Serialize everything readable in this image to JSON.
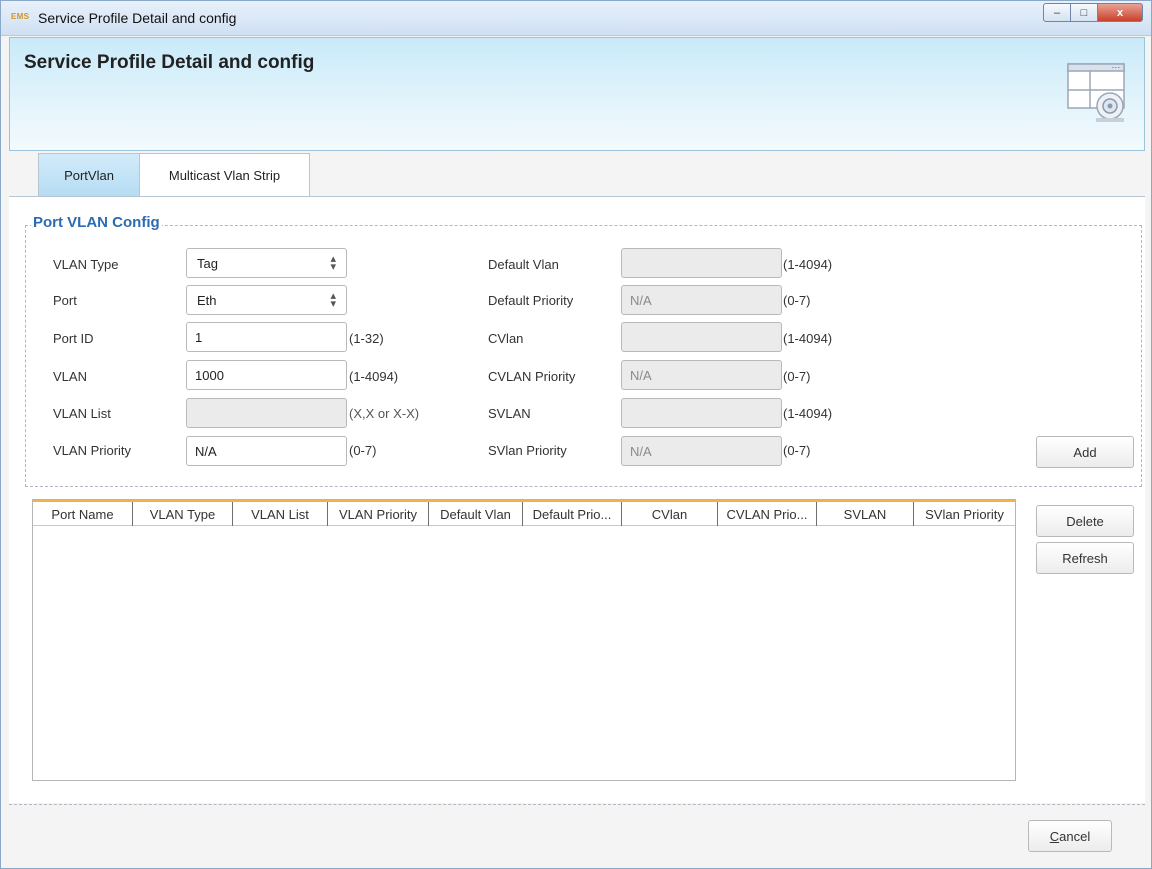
{
  "window": {
    "app_badge": "EMS",
    "title": "Service Profile Detail and config",
    "controls": {
      "minimize": "–",
      "maximize": "□",
      "close": "x"
    }
  },
  "banner": {
    "title": "Service Profile Detail and config",
    "icon": "window-config-icon"
  },
  "tabs": [
    {
      "label": "PortVlan",
      "active": true
    },
    {
      "label": "Multicast Vlan Strip",
      "active": false
    }
  ],
  "port_vlan_config": {
    "group_title": "Port VLAN Config",
    "vlan_type": {
      "label": "VLAN Type",
      "value": "Tag"
    },
    "port": {
      "label": "Port",
      "value": "Eth"
    },
    "port_id": {
      "label": "Port ID",
      "value": "1",
      "hint": "(1-32)"
    },
    "vlan": {
      "label": "VLAN",
      "value": "1000",
      "hint": "(1-4094)"
    },
    "vlan_list": {
      "label": "VLAN List",
      "value": "",
      "hint": "(X,X or X-X)"
    },
    "vlan_priority": {
      "label": "VLAN Priority",
      "value": "N/A",
      "hint": "(0-7)"
    },
    "default_vlan": {
      "label": "Default Vlan",
      "value": "",
      "hint": "(1-4094)"
    },
    "default_priority": {
      "label": "Default Priority",
      "value": "N/A",
      "hint": "(0-7)"
    },
    "cvlan": {
      "label": "CVlan",
      "value": "",
      "hint": "(1-4094)"
    },
    "cvlan_priority": {
      "label": "CVLAN Priority",
      "value": "N/A",
      "hint": "(0-7)"
    },
    "svlan": {
      "label": "SVLAN",
      "value": "",
      "hint": "(1-4094)"
    },
    "svlan_priority": {
      "label": "SVlan Priority",
      "value": "N/A",
      "hint": "(0-7)"
    },
    "add_label": "Add"
  },
  "table": {
    "columns": [
      "Port Name",
      "VLAN Type",
      "VLAN List",
      "VLAN Priority",
      "Default Vlan",
      "Default Prio...",
      "CVlan",
      "CVLAN Prio...",
      "SVLAN",
      "SVlan Priority"
    ],
    "rows": []
  },
  "actions": {
    "delete_label": "Delete",
    "refresh_label": "Refresh",
    "cancel_first": "C",
    "cancel_rest": "ancel"
  }
}
